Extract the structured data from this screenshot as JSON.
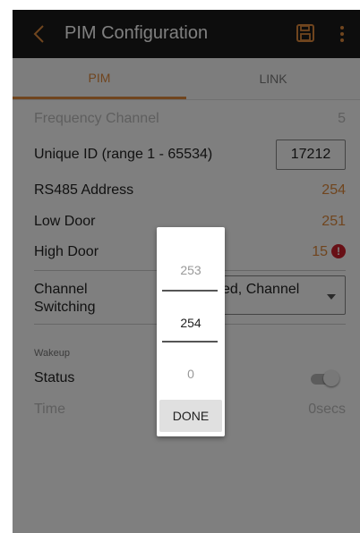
{
  "app": {
    "title": "PIM Configuration"
  },
  "tabs": [
    {
      "label": "PIM"
    },
    {
      "label": "LINK"
    }
  ],
  "settings": {
    "frequency_channel": {
      "label": "Frequency Channel",
      "value": "5"
    },
    "unique_id": {
      "label": "Unique ID (range 1 - 65534)",
      "value": "17212"
    },
    "rs485_address": {
      "label": "RS485 Address",
      "value": "254"
    },
    "low_door": {
      "label": "Low Door",
      "value": "251"
    },
    "high_door": {
      "label": "High Door",
      "value": "15",
      "warning_icon": "!"
    },
    "channel_switching": {
      "label": "Channel Switching",
      "value": "ed, Channel"
    }
  },
  "wakeup": {
    "section_label": "Wakeup",
    "status_label": "Status",
    "status_on": false,
    "time_label": "Time",
    "time_value": "0secs"
  },
  "picker": {
    "above": "253",
    "selected": "254",
    "below": "0",
    "done_label": "DONE"
  },
  "colors": {
    "accent": "#e08a3d",
    "topbar": "#1b1b1b",
    "warning": "#d0202c"
  },
  "icons": [
    "back-chevron-icon",
    "save-icon",
    "more-vert-icon",
    "warning-icon",
    "dropdown-caret-icon"
  ]
}
